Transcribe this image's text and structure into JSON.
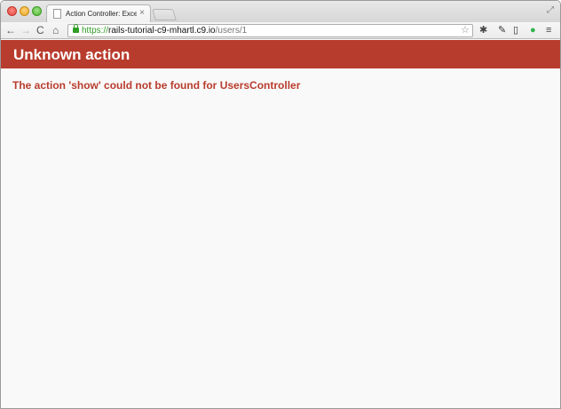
{
  "browser": {
    "tab": {
      "title": "Action Controller: Exception caught",
      "close_glyph": "×"
    },
    "toolbar": {
      "back_glyph": "←",
      "forward_glyph": "→",
      "reload_glyph": "C",
      "home_glyph": "⌂",
      "menu_glyph": "≡",
      "star_glyph": "☆"
    },
    "address_bar": {
      "scheme": "https://",
      "host": "rails-tutorial-c9-mhartl.c9.io",
      "path": "/users/1"
    },
    "icons": [
      "gear-icon",
      "pen-extension-icon",
      "phone-extension-icon",
      "evernote-icon",
      "menu-icon"
    ]
  },
  "page": {
    "header_title": "Unknown action",
    "message": "The action 'show' could not be found for UsersController",
    "colors": {
      "header_bg": "#b83c2d",
      "message_text": "#b83c2d"
    }
  }
}
